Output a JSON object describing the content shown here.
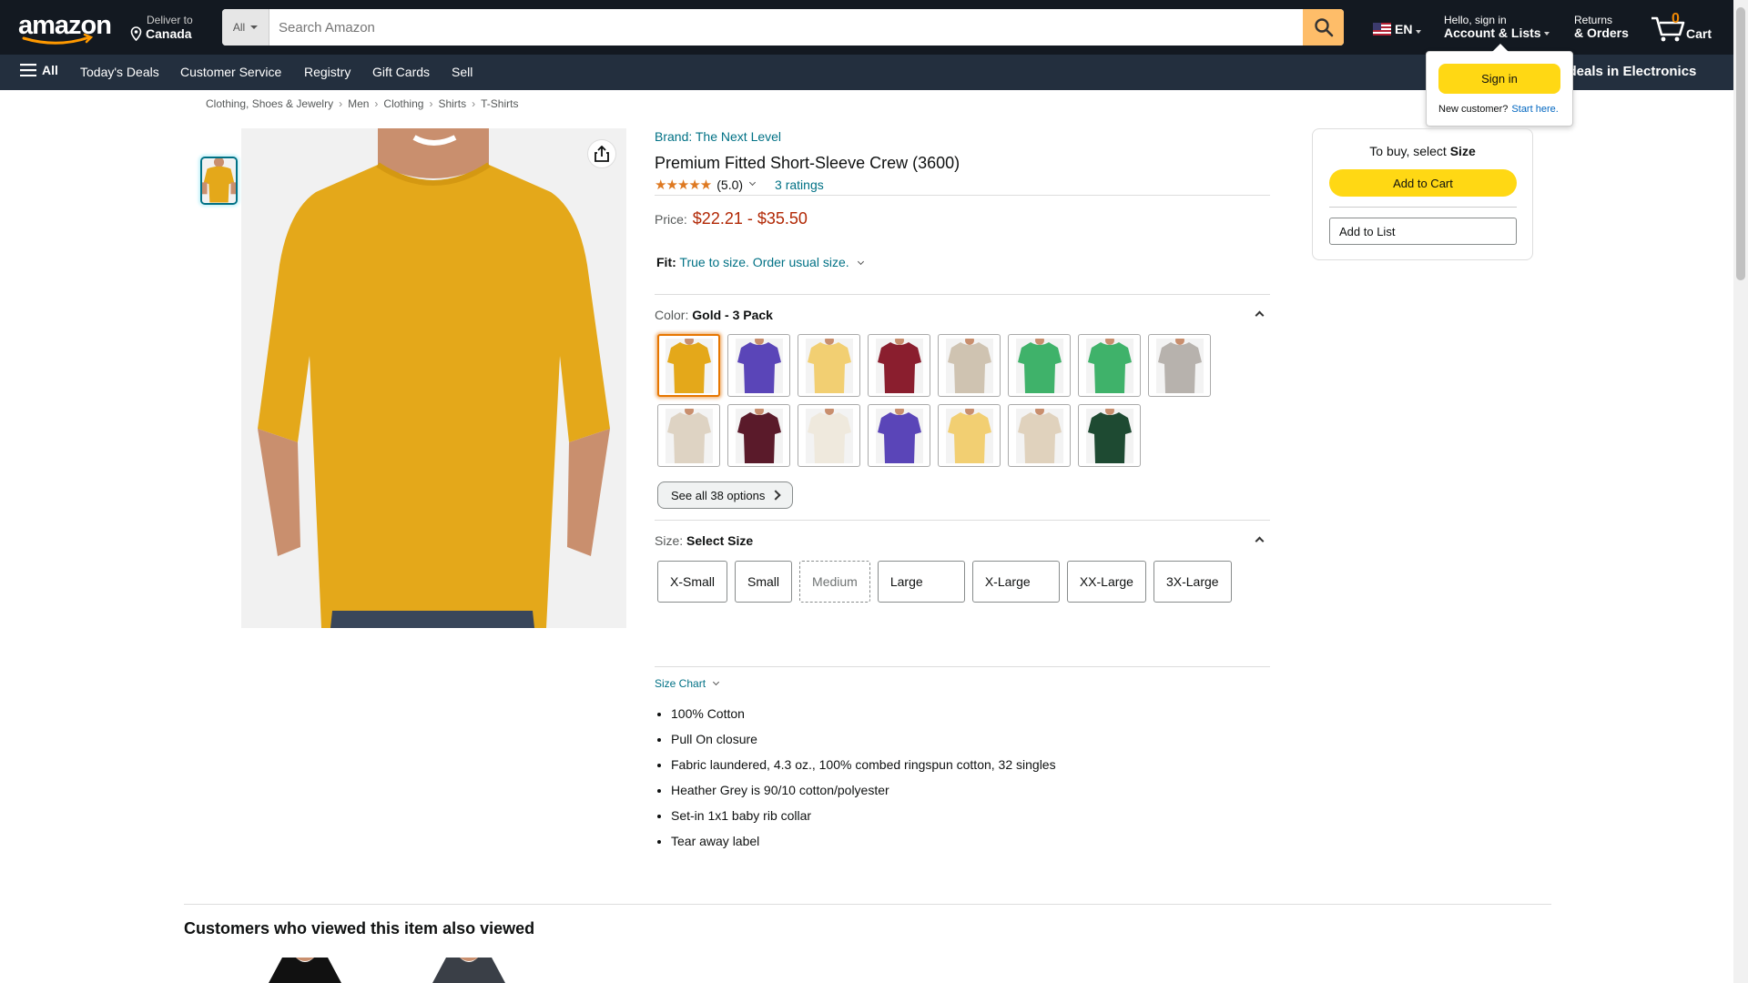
{
  "header": {
    "deliver_line1": "Deliver to",
    "deliver_line2": "Canada",
    "search_category": "All",
    "search_placeholder": "Search Amazon",
    "language": "EN",
    "account_line1": "Hello, sign in",
    "account_line2": "Account & Lists",
    "returns_line1": "Returns",
    "returns_line2": "& Orders",
    "cart_count": "0",
    "cart_label": "Cart"
  },
  "nav": {
    "all_label": "All",
    "items": [
      "Today's Deals",
      "Customer Service",
      "Registry",
      "Gift Cards",
      "Sell"
    ],
    "promo": "op deals in Electronics"
  },
  "signin_popover": {
    "button": "Sign in",
    "new_customer": "New customer?",
    "start_here": "Start here."
  },
  "breadcrumb": [
    "Clothing, Shoes & Jewelry",
    "Men",
    "Clothing",
    "Shirts",
    "T-Shirts"
  ],
  "product": {
    "brand": "Brand: The Next Level",
    "title": "Premium Fitted Short-Sleeve Crew (3600)",
    "rating_value": 5.0,
    "rating_text": "(5.0)",
    "ratings_count": "3 ratings",
    "price_label": "Price:",
    "price_range": "$22.21 - $35.50",
    "fit_label": "Fit:",
    "fit_text": "True to size. Order usual size.",
    "color_label": "Color:",
    "color_value": "Gold - 3 Pack",
    "swatch_colors": [
      "#e4a81a",
      "#5a45b8",
      "#f2cf72",
      "#8a1e2e",
      "#cfc3b1",
      "#3fb26a",
      "#3fb26a",
      "#b7b2ad",
      "#ded3c3",
      "#5a1a2a",
      "#efe9dd",
      "#5a45b8",
      "#f2cf72",
      "#e0d2bd",
      "#1e4a32"
    ],
    "see_all": "See all 38 options",
    "size_label": "Size:",
    "size_value": "Select Size",
    "sizes": [
      "X-Small",
      "Small",
      "Medium",
      "Large",
      "X-Large",
      "XX-Large",
      "3X-Large"
    ],
    "size_chart": "Size Chart",
    "bullets": [
      "100% Cotton",
      "Pull On closure",
      "Fabric laundered, 4.3 oz., 100% combed ringspun cotton, 32 singles",
      "Heather Grey is 90/10 cotton/polyester",
      "Set-in 1x1 baby rib collar",
      "Tear away label"
    ]
  },
  "buybox": {
    "prompt": "To buy, select",
    "prompt_bold": "Size",
    "add_to_cart": "Add to Cart",
    "add_to_list": "Add to List"
  },
  "related": {
    "title": "Customers who viewed this item also viewed"
  },
  "colors": {
    "header_bg": "#131921",
    "nav_bg": "#232f3e",
    "accent": "#febd69",
    "button_yellow": "#ffd814",
    "link": "#007185",
    "price": "#b12704"
  }
}
